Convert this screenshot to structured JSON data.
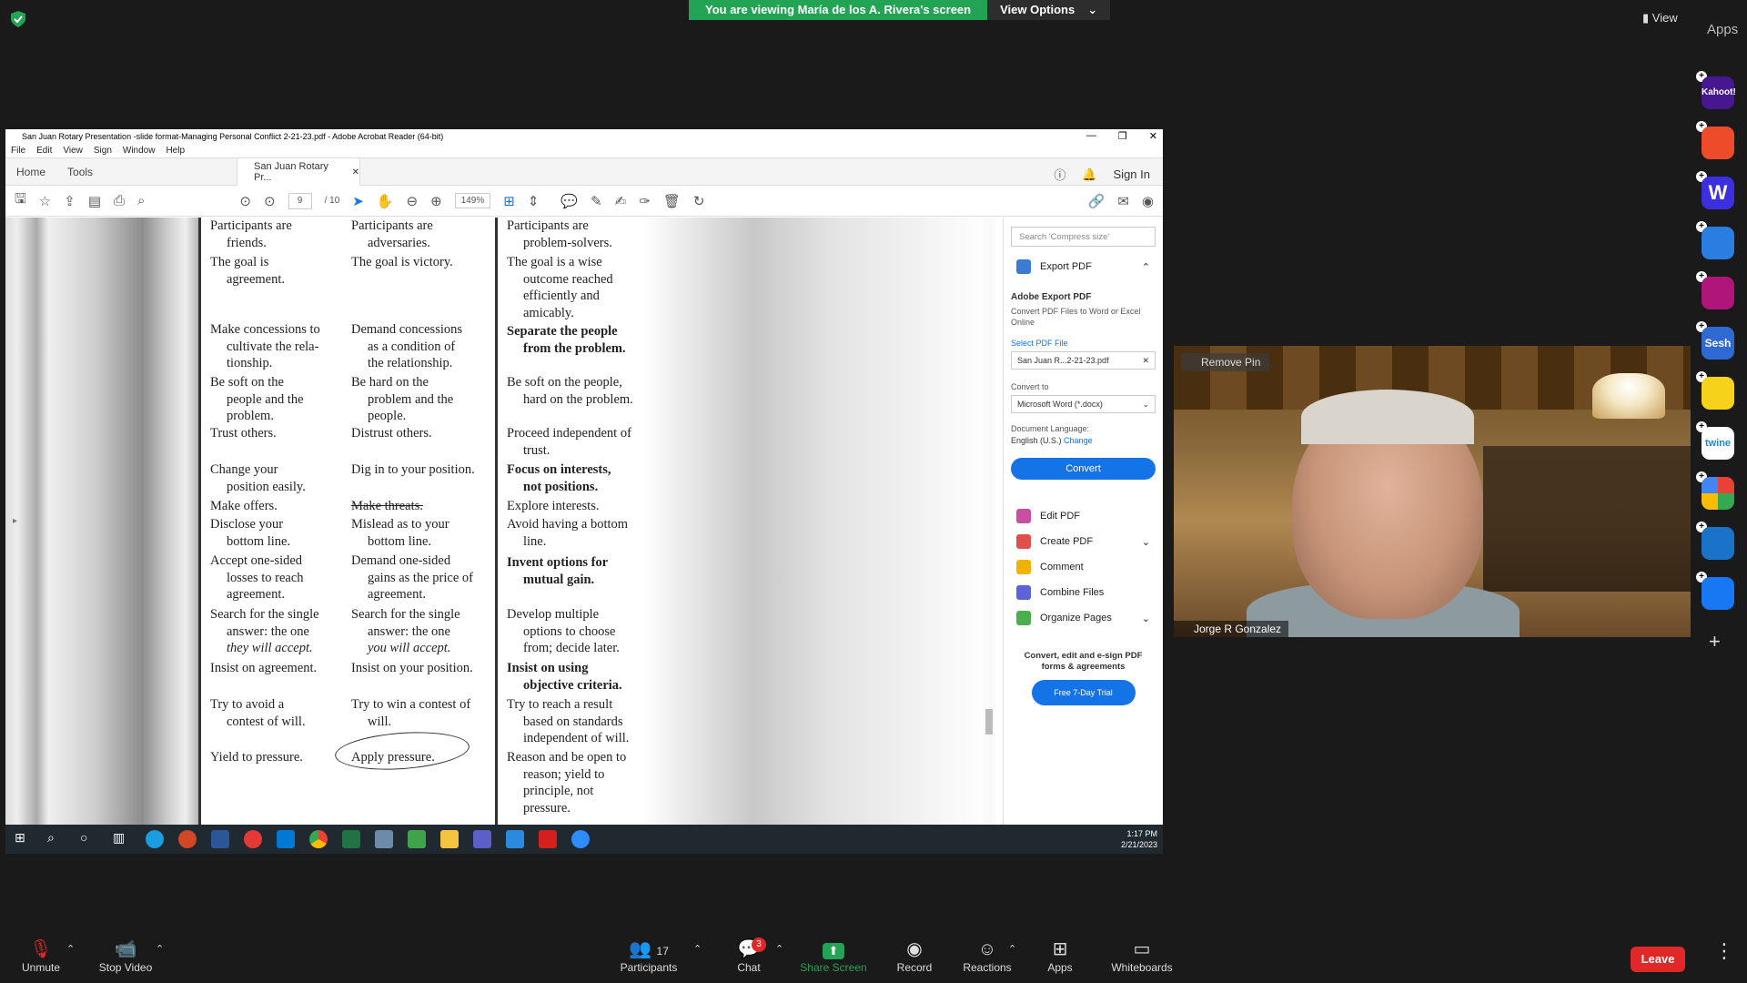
{
  "zoom_meeting": {
    "banner": "You are viewing María de los A. Rivera's screen",
    "view_options": "View Options",
    "view_button": "View",
    "apps_title": "Apps"
  },
  "acrobat": {
    "window_title": "San Juan Rotary Presentation -slide format-Managing Personal Conflict 2-21-23.pdf - Adobe Acrobat Reader (64-bit)",
    "menu": [
      "File",
      "Edit",
      "View",
      "Sign",
      "Window",
      "Help"
    ],
    "tabs": {
      "home": "Home",
      "tools": "Tools",
      "document": "San Juan Rotary Pr..."
    },
    "sign_in": "Sign In",
    "page_current": "9",
    "page_total": "/ 10",
    "zoom": "149%",
    "search_placeholder": "Search 'Compress size'",
    "export_pdf": "Export PDF",
    "adobe_export_title": "Adobe Export PDF",
    "adobe_export_desc": "Convert PDF Files to Word or Excel Online",
    "select_pdf": "Select PDF File",
    "selected_file": "San Juan R...2-21-23.pdf",
    "convert_to": "Convert to",
    "convert_format": "Microsoft Word (*.docx)",
    "doc_language_label": "Document Language:",
    "doc_language": "English (U.S.)",
    "change_link": "Change",
    "convert_button": "Convert",
    "tools_list": [
      "Edit PDF",
      "Create PDF",
      "Comment",
      "Combine Files",
      "Organize Pages"
    ],
    "promo": "Convert, edit and e-sign PDF forms & agreements",
    "trial_button": "Free 7-Day Trial"
  },
  "document": {
    "col1": [
      "Participants are",
      "friends.",
      "The goal is",
      "agreement.",
      "Make concessions to",
      "cultivate the rela-",
      "tionship.",
      "Be soft on the",
      "people and the",
      "problem.",
      "Trust others.",
      "Change your",
      "position easily.",
      "Make offers.",
      "Disclose your",
      "bottom line.",
      "Accept one-sided",
      "losses to reach",
      "agreement.",
      "Search for the single",
      "answer: the one",
      "they will accept.",
      "Insist on agreement.",
      "Try to avoid a",
      "contest of will.",
      "Yield to pressure."
    ],
    "col2": [
      "Participants are",
      "adversaries.",
      "The goal is victory.",
      "Demand concessions",
      "as a condition of",
      "the relationship.",
      "Be hard on the",
      "problem and the",
      "people.",
      "Distrust others.",
      "Dig in to your position.",
      "Make threats.",
      "Mislead as to your",
      "bottom line.",
      "Demand one-sided",
      "gains as the price of",
      "agreement.",
      "Search for the single",
      "answer: the one",
      "you will accept.",
      "Insist on your position.",
      "Try to win a contest of",
      "will.",
      "Apply pressure."
    ],
    "col3": [
      "Participants are",
      "problem-solvers.",
      "The goal is a wise",
      "outcome reached",
      "efficiently and",
      "amicably.",
      "Separate the people",
      "from the problem.",
      "Be soft on the people,",
      "hard on the problem.",
      "Proceed independent of",
      "trust.",
      "Focus on interests,",
      "not positions.",
      "Explore interests.",
      "Avoid having a bottom",
      "line.",
      "Invent options for",
      "mutual gain.",
      "Develop multiple",
      "options to choose",
      "from; decide later.",
      "Insist on using",
      "objective criteria.",
      "Try to reach a result",
      "based on standards",
      "independent of will.",
      "Reason and be open to",
      "reason; yield to",
      "principle, not",
      "pressure."
    ]
  },
  "taskbar": {
    "time": "1:17 PM",
    "date": "2/21/2023"
  },
  "video": {
    "remove_pin": "Remove Pin",
    "participant_name": "Jorge R Gonzalez"
  },
  "apps_rail": [
    "Kahoot!",
    "Sesh",
    "twine"
  ],
  "controls": {
    "unmute": "Unmute",
    "stop_video": "Stop Video",
    "participants": "Participants",
    "participants_count": "17",
    "chat": "Chat",
    "chat_badge": "3",
    "share_screen": "Share Screen",
    "record": "Record",
    "reactions": "Reactions",
    "apps": "Apps",
    "whiteboards": "Whiteboards",
    "leave": "Leave"
  },
  "colors": {
    "share_green": "#23a455",
    "leave_red": "#e02828",
    "adobe_blue": "#1473e6"
  }
}
